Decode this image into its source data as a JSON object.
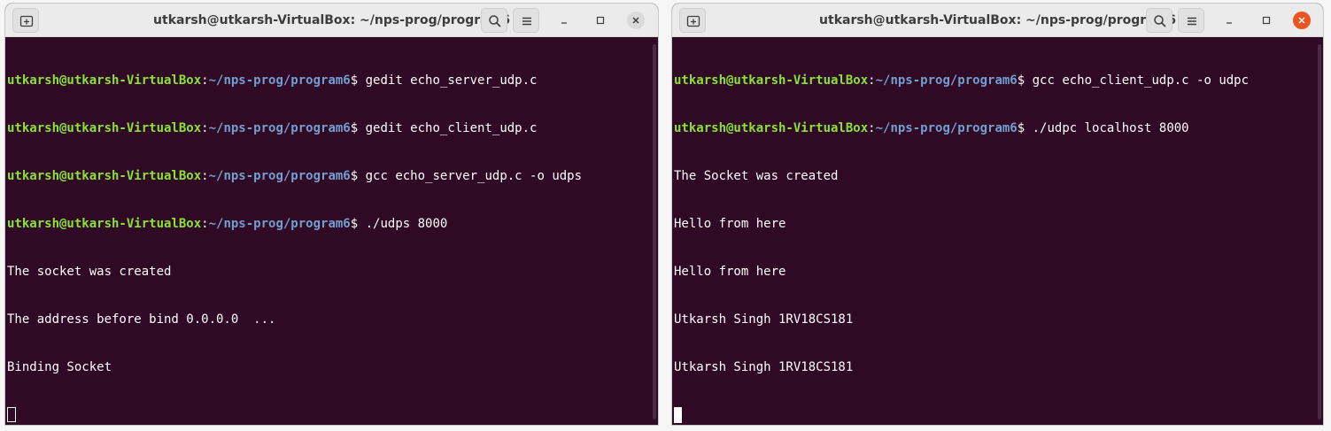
{
  "left_window": {
    "title": "utkarsh@utkarsh-VirtualBox: ~/nps-prog/program6",
    "prompt_lines": [
      {
        "user": "utkarsh@utkarsh-VirtualBox",
        "colon": ":",
        "path": "~/nps-prog/program6",
        "cmd": "$ gedit echo_server_udp.c"
      },
      {
        "user": "utkarsh@utkarsh-VirtualBox",
        "colon": ":",
        "path": "~/nps-prog/program6",
        "cmd": "$ gedit echo_client_udp.c"
      },
      {
        "user": "utkarsh@utkarsh-VirtualBox",
        "colon": ":",
        "path": "~/nps-prog/program6",
        "cmd": "$ gcc echo_server_udp.c -o udps"
      },
      {
        "user": "utkarsh@utkarsh-VirtualBox",
        "colon": ":",
        "path": "~/nps-prog/program6",
        "cmd": "$ ./udps 8000"
      }
    ],
    "output_lines": [
      "The socket was created",
      "The address before bind 0.0.0.0  ...",
      "Binding Socket"
    ]
  },
  "right_window": {
    "title": "utkarsh@utkarsh-VirtualBox: ~/nps-prog/program6",
    "prompt_lines": [
      {
        "user": "utkarsh@utkarsh-VirtualBox",
        "colon": ":",
        "path": "~/nps-prog/program6",
        "cmd": "$ gcc echo_client_udp.c -o udpc"
      },
      {
        "user": "utkarsh@utkarsh-VirtualBox",
        "colon": ":",
        "path": "~/nps-prog/program6",
        "cmd": "$ ./udpc localhost 8000"
      }
    ],
    "output_lines": [
      "The Socket was created",
      "Hello from here",
      "Hello from here",
      "Utkarsh Singh 1RV18CS181",
      "Utkarsh Singh 1RV18CS181"
    ]
  },
  "icons": {
    "new_tab": "new-tab-icon",
    "search": "search-icon",
    "menu": "hamburger-menu-icon",
    "minimize": "minimize-icon",
    "maximize": "maximize-icon",
    "close": "close-icon"
  },
  "colors": {
    "terminal_bg": "#300a24",
    "user": "#8ae234",
    "path": "#729fcf",
    "text": "#ffffff",
    "close_active": "#e95420"
  }
}
